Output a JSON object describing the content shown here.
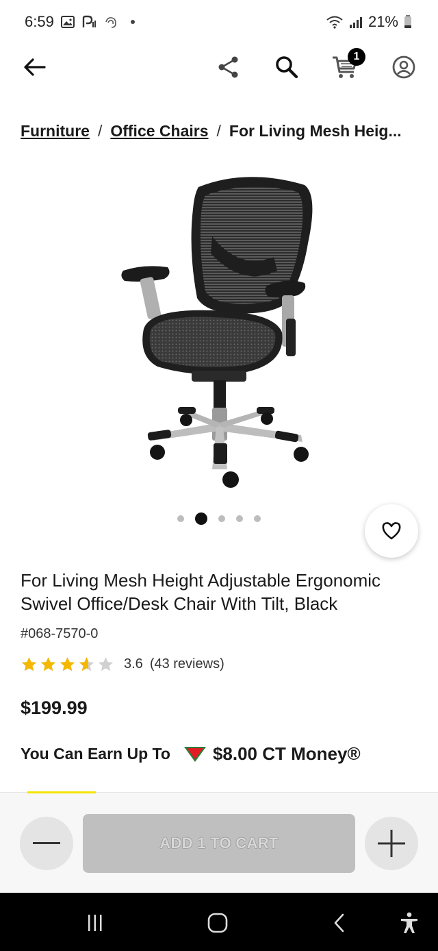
{
  "status_bar": {
    "time": "6:59",
    "battery": "21%"
  },
  "header": {
    "cart_count": "1"
  },
  "breadcrumb": {
    "items": [
      "Furniture",
      "Office Chairs"
    ],
    "separator": "/",
    "current": "For Living Mesh Heig..."
  },
  "product": {
    "title": "For Living Mesh Height Adjustable Ergonomic Swivel Office/Desk Chair With Tilt, Black",
    "sku": "#068-7570-0",
    "rating": 3.6,
    "rating_text": "3.6",
    "reviews_text": "(43 reviews)",
    "price": "$199.99",
    "carousel": {
      "count": 5,
      "active_index": 1
    }
  },
  "ct_money": {
    "label": "You Can Earn Up To",
    "amount": "$8.00 CT Money®"
  },
  "action_bar": {
    "add_to_cart_label": "ADD 1 TO CART"
  },
  "colors": {
    "star": "#f5b800",
    "star_empty": "#d0d0d0",
    "ct_red": "#e31b23",
    "accent_yellow": "#f5e400"
  }
}
